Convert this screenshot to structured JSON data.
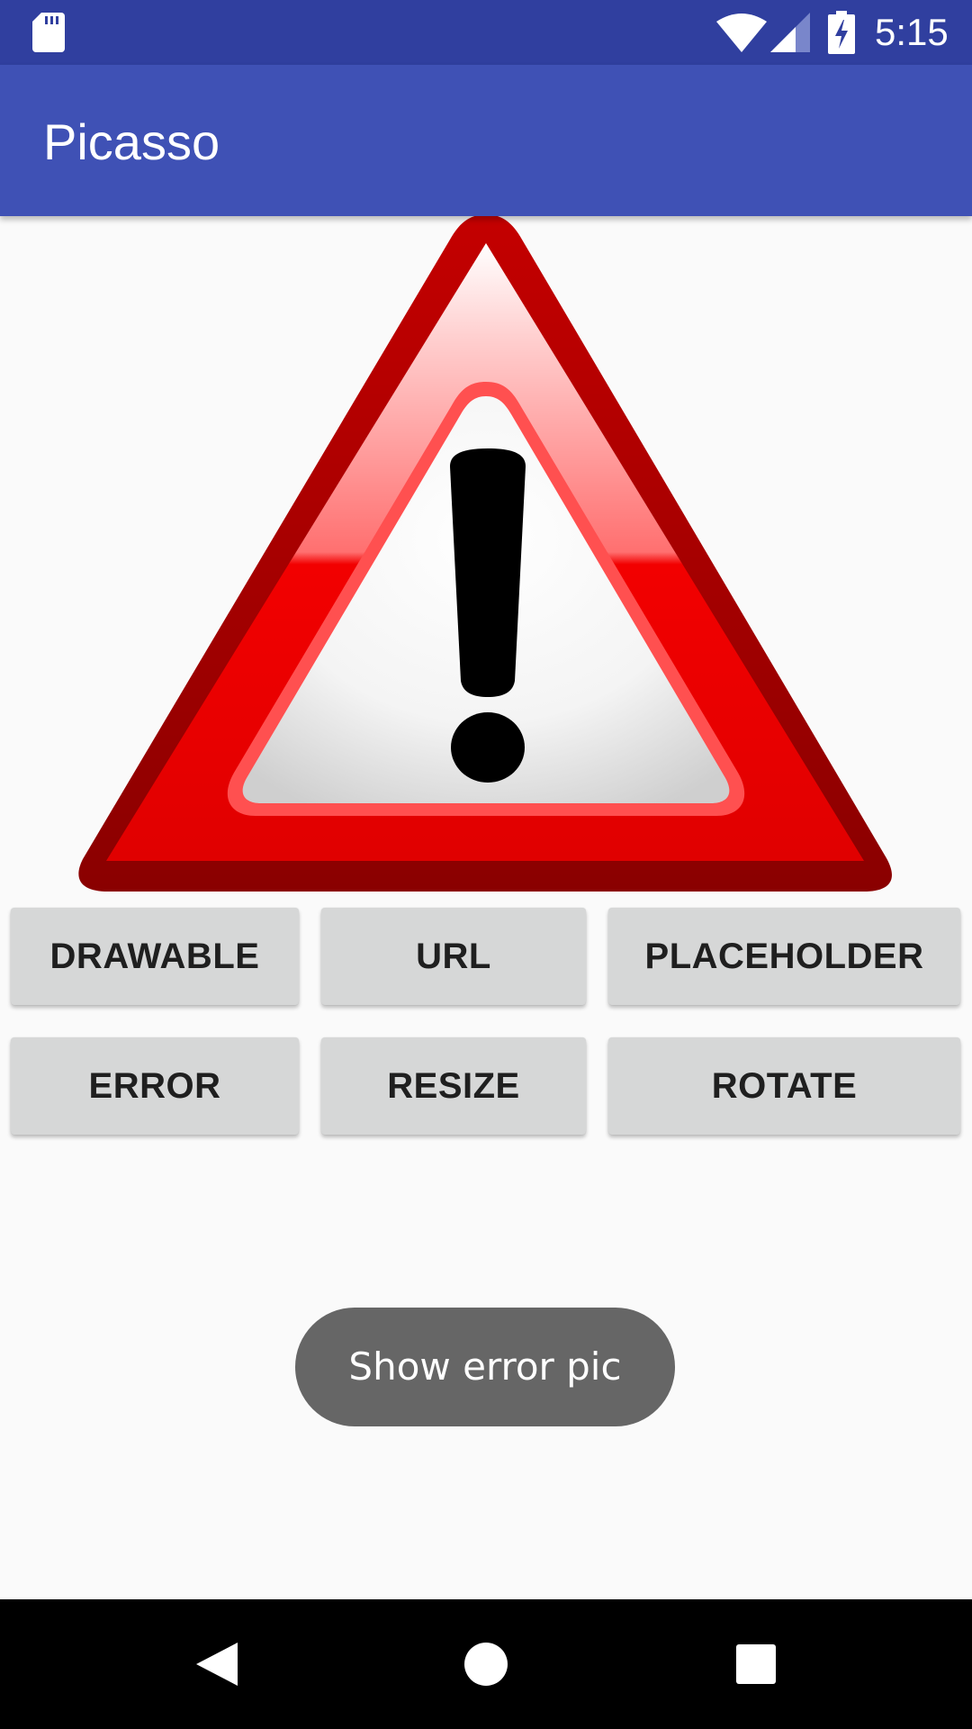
{
  "status_bar": {
    "time": "5:15",
    "icons": [
      "sd-card-icon",
      "wifi-icon",
      "signal-icon",
      "battery-charging-icon"
    ]
  },
  "app_bar": {
    "title": "Picasso"
  },
  "image": {
    "icon": "warning-triangle-icon",
    "colors": {
      "outer": "#c00000",
      "inner": "#f20000",
      "exclamation": "#000000"
    }
  },
  "buttons": {
    "drawable": "DRAWABLE",
    "url": "URL",
    "placeholder": "PLACEHOLDER",
    "error": "ERROR",
    "resize": "RESIZE",
    "rotate": "ROTATE"
  },
  "toast": {
    "message": "Show error pic"
  },
  "nav_bar": {
    "icons": [
      "back-icon",
      "home-icon",
      "recents-icon"
    ]
  },
  "colors": {
    "status_bar": "#303f9f",
    "app_bar": "#3f51b5",
    "button_bg": "#d6d7d7",
    "toast_bg": "#666666",
    "background": "#fafafa"
  }
}
